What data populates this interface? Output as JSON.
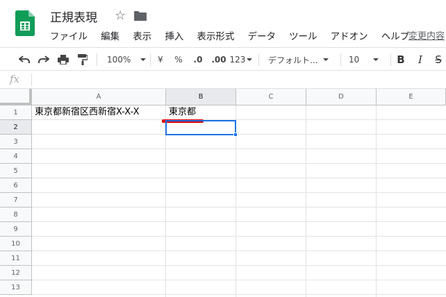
{
  "doc": {
    "title": "正規表現",
    "last_edit": "変更内容"
  },
  "menu": [
    "ファイル",
    "編集",
    "表示",
    "挿入",
    "表示形式",
    "データ",
    "ツール",
    "アドオン",
    "ヘルプ"
  ],
  "toolbar": {
    "zoom": "100%",
    "currency": "¥",
    "percent": "%",
    "decrease_decimal": ".0",
    "increase_decimal": ".00",
    "more_formats": "123",
    "font": "デフォルト...",
    "font_size": "10",
    "bold": "B",
    "italic": "I",
    "strike": "S"
  },
  "formula_bar": {
    "label": "fx",
    "value": ""
  },
  "columns": [
    "A",
    "B",
    "C",
    "D",
    "E"
  ],
  "rows": [
    "1",
    "2",
    "3",
    "4",
    "5",
    "6",
    "7",
    "8",
    "9",
    "10",
    "11",
    "12",
    "13"
  ],
  "cells": {
    "A1": "東京都新宿区西新宿X-X-X",
    "B1": "東京都"
  },
  "selected_cell": "B2",
  "colors": {
    "brand_green": "#0f9d58",
    "selection_blue": "#1a73e8",
    "annotation_red": "#e00000"
  }
}
